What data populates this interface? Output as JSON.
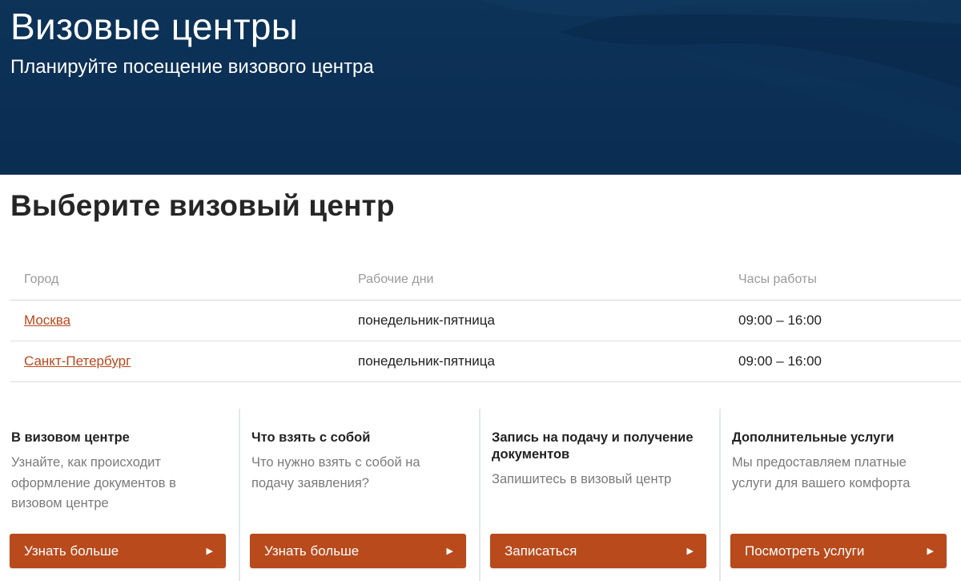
{
  "hero": {
    "title": "Визовые центры",
    "subtitle": "Планируйте посещение визового центра",
    "background_color": "#0b2f55"
  },
  "section": {
    "title": "Выберите визовый центр"
  },
  "table": {
    "headers": {
      "city": "Город",
      "days": "Рабочие дни",
      "hours": "Часы работы"
    },
    "rows": [
      {
        "city": "Москва",
        "days": "понедельник-пятница",
        "hours": "09:00 – 16:00"
      },
      {
        "city": "Санкт-Петербург",
        "days": "понедельник-пятница",
        "hours": "09:00 – 16:00"
      }
    ],
    "link_color": "#b9471b"
  },
  "cards": [
    {
      "title": "В визовом центре",
      "text": "Узнайте, как происходит оформление документов в визовом центре",
      "button": "Узнать больше"
    },
    {
      "title": "Что взять с собой",
      "text": "Что нужно взять с собой на подачу заявления?",
      "button": "Узнать больше"
    },
    {
      "title": "Запись на подачу и получение документов",
      "text": "Запишитесь в визовый центр",
      "button": "Записаться"
    },
    {
      "title": "Дополнительные услуги",
      "text": "Мы предоставляем платные услуги для вашего комфорта",
      "button": "Посмотреть услуги"
    }
  ],
  "button_icon": "play-arrow-icon",
  "button_color": "#b84a1c"
}
